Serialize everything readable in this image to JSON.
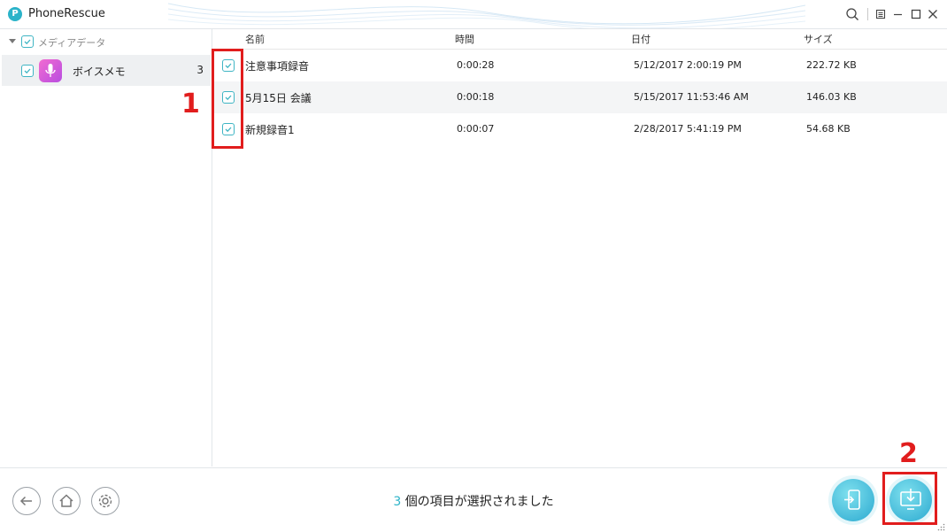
{
  "window": {
    "title": "PhoneRescue",
    "logo_letter": "P"
  },
  "sidebar": {
    "category": {
      "label": "メディアデータ",
      "checked": true
    },
    "items": [
      {
        "label": "ボイスメモ",
        "count": "3",
        "checked": true,
        "icon": "microphone-icon"
      }
    ]
  },
  "table": {
    "columns": [
      "名前",
      "時間",
      "日付",
      "サイズ"
    ],
    "rows": [
      {
        "name": "注意事項録音",
        "duration": "0:00:28",
        "date": "5/12/2017 2:00:19 PM",
        "size": "222.72 KB",
        "checked": true
      },
      {
        "name": "5月15日 会議",
        "duration": "0:00:18",
        "date": "5/15/2017 11:53:46 AM",
        "size": "146.03 KB",
        "checked": true
      },
      {
        "name": "新規録音1",
        "duration": "0:00:07",
        "date": "2/28/2017 5:41:19 PM",
        "size": "54.68 KB",
        "checked": true
      }
    ]
  },
  "footer": {
    "selected_count": "3",
    "status_text": "個の項目が選択されました"
  },
  "annotations": {
    "step1": "1",
    "step2": "2"
  },
  "colors": {
    "accent": "#2cb3c8",
    "annotation": "#e11d1d",
    "voice_memo_icon": "#d65de0"
  }
}
